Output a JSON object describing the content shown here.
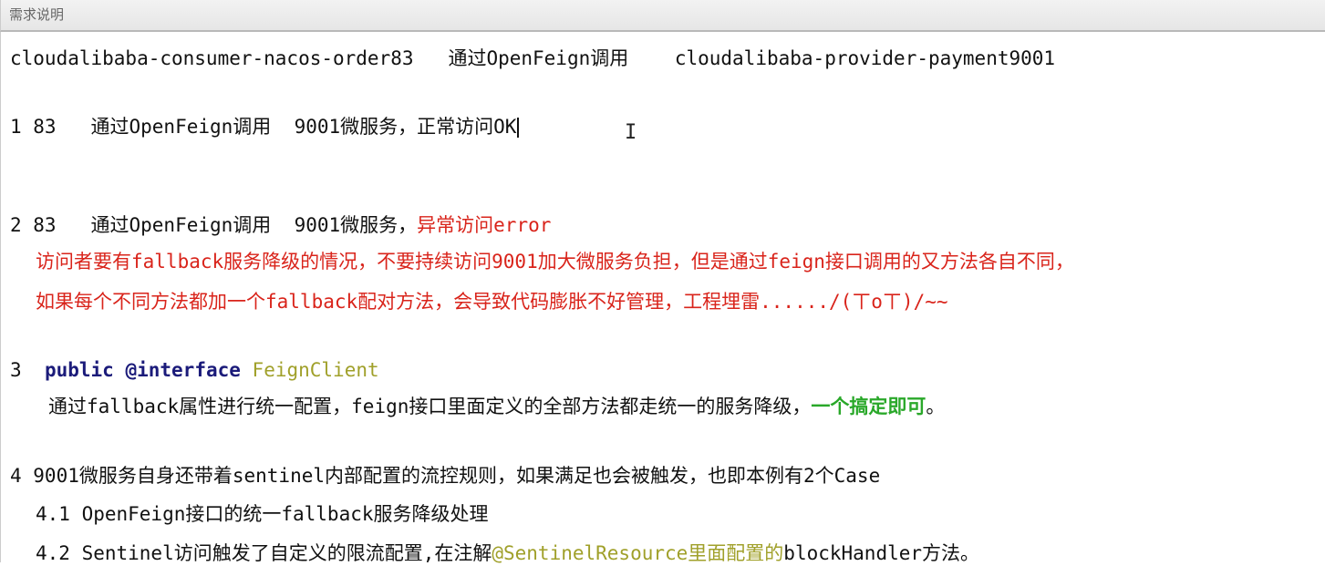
{
  "title": "需求说明",
  "line0": {
    "consumer": "cloudalibaba-consumer-nacos-order83",
    "via": "通过OpenFeign调用",
    "provider": "cloudalibaba-provider-payment9001"
  },
  "item1": {
    "prefix": "1 83   通过OpenFeign调用  9001微服务，正常访问OK"
  },
  "item2": {
    "prefix": "2 83   通过OpenFeign调用  9001微服务，",
    "red": "异常访问error",
    "detail1": "访问者要有fallback服务降级的情况，不要持续访问9001加大微服务负担，但是通过feign接口调用的又方法各自不同，",
    "detail2": "如果每个不同方法都加一个fallback配对方法，会导致代码膨胀不好管理，工程埋雷....../(ㄒoㄒ)/~~"
  },
  "item3": {
    "num": "3 ",
    "kw": "public @interface",
    "cls": "FeignClient",
    "desc": "通过fallback属性进行统一配置，feign接口里面定义的全部方法都走统一的服务降级，",
    "green": "一个搞定即可",
    "end": "。"
  },
  "item4": {
    "main": "4 9001微服务自身还带着sentinel内部配置的流控规则，如果满足也会被触发，也即本例有2个Case",
    "sub1": "4.1 OpenFeign接口的统一fallback服务降级处理",
    "sub2a": "4.2 Sentinel访问触发了自定义的限流配置,在注解",
    "sub2b": "@SentinelResource里面配置的",
    "sub2c": "blockHandler方法。"
  }
}
